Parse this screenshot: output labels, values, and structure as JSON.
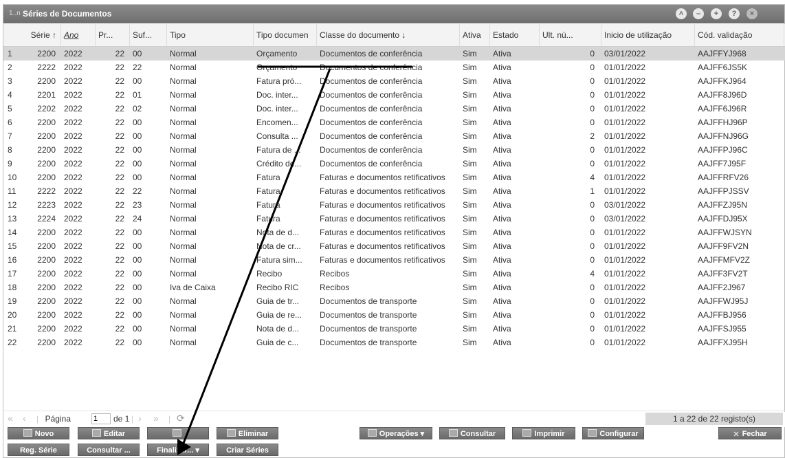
{
  "window": {
    "title": "Séries de Documentos",
    "title_icon": "1..n"
  },
  "columns": [
    {
      "label": "Série ↑"
    },
    {
      "label": "Ano"
    },
    {
      "label": "Pr..."
    },
    {
      "label": "Suf..."
    },
    {
      "label": "Tipo"
    },
    {
      "label": "Tipo documen"
    },
    {
      "label": "Classe do documento ↓"
    },
    {
      "label": "Ativa"
    },
    {
      "label": "Estado"
    },
    {
      "label": "Ult. nú..."
    },
    {
      "label": "Inicio de utilização"
    },
    {
      "label": "Cód. validação"
    }
  ],
  "rows": [
    {
      "n": "1",
      "serie": "2200",
      "ano": "2022",
      "pr": "22",
      "suf": "00",
      "tipo": "Normal",
      "tipodoc": "Orçamento",
      "classe": "Documentos de conferência",
      "ativa": "Sim",
      "estado": "Ativa",
      "ult": "0",
      "inicio": "03/01/2022",
      "cod": "AAJFFYJ968"
    },
    {
      "n": "2",
      "serie": "2222",
      "ano": "2022",
      "pr": "22",
      "suf": "22",
      "tipo": "Normal",
      "tipodoc": "Orçamento",
      "classe": "Documentos de conferência",
      "ativa": "Sim",
      "estado": "Ativa",
      "ult": "0",
      "inicio": "01/01/2022",
      "cod": "AAJFF6JS5K"
    },
    {
      "n": "3",
      "serie": "2200",
      "ano": "2022",
      "pr": "22",
      "suf": "00",
      "tipo": "Normal",
      "tipodoc": "Fatura pró...",
      "classe": "Documentos de conferência",
      "ativa": "Sim",
      "estado": "Ativa",
      "ult": "0",
      "inicio": "01/01/2022",
      "cod": "AAJFFKJ964"
    },
    {
      "n": "4",
      "serie": "2201",
      "ano": "2022",
      "pr": "22",
      "suf": "01",
      "tipo": "Normal",
      "tipodoc": "Doc. inter...",
      "classe": "Documentos de conferência",
      "ativa": "Sim",
      "estado": "Ativa",
      "ult": "0",
      "inicio": "01/01/2022",
      "cod": "AAJFF8J96D"
    },
    {
      "n": "5",
      "serie": "2202",
      "ano": "2022",
      "pr": "22",
      "suf": "02",
      "tipo": "Normal",
      "tipodoc": "Doc. inter...",
      "classe": "Documentos de conferência",
      "ativa": "Sim",
      "estado": "Ativa",
      "ult": "0",
      "inicio": "01/01/2022",
      "cod": "AAJFF6J96R"
    },
    {
      "n": "6",
      "serie": "2200",
      "ano": "2022",
      "pr": "22",
      "suf": "00",
      "tipo": "Normal",
      "tipodoc": "Encomen...",
      "classe": "Documentos de conferência",
      "ativa": "Sim",
      "estado": "Ativa",
      "ult": "0",
      "inicio": "01/01/2022",
      "cod": "AAJFFHJ96P"
    },
    {
      "n": "7",
      "serie": "2200",
      "ano": "2022",
      "pr": "22",
      "suf": "00",
      "tipo": "Normal",
      "tipodoc": "Consulta ...",
      "classe": "Documentos de conferência",
      "ativa": "Sim",
      "estado": "Ativa",
      "ult": "2",
      "inicio": "01/01/2022",
      "cod": "AAJFFNJ96G"
    },
    {
      "n": "8",
      "serie": "2200",
      "ano": "2022",
      "pr": "22",
      "suf": "00",
      "tipo": "Normal",
      "tipodoc": "Fatura de ...",
      "classe": "Documentos de conferência",
      "ativa": "Sim",
      "estado": "Ativa",
      "ult": "0",
      "inicio": "01/01/2022",
      "cod": "AAJFFPJ96C"
    },
    {
      "n": "9",
      "serie": "2200",
      "ano": "2022",
      "pr": "22",
      "suf": "00",
      "tipo": "Normal",
      "tipodoc": "Crédito de...",
      "classe": "Documentos de conferência",
      "ativa": "Sim",
      "estado": "Ativa",
      "ult": "0",
      "inicio": "01/01/2022",
      "cod": "AAJFF7J95F"
    },
    {
      "n": "10",
      "serie": "2200",
      "ano": "2022",
      "pr": "22",
      "suf": "00",
      "tipo": "Normal",
      "tipodoc": "Fatura",
      "classe": "Faturas e documentos retificativos",
      "ativa": "Sim",
      "estado": "Ativa",
      "ult": "4",
      "inicio": "01/01/2022",
      "cod": "AAJFFRFV26"
    },
    {
      "n": "11",
      "serie": "2222",
      "ano": "2022",
      "pr": "22",
      "suf": "22",
      "tipo": "Normal",
      "tipodoc": "Fatura",
      "classe": "Faturas e documentos retificativos",
      "ativa": "Sim",
      "estado": "Ativa",
      "ult": "1",
      "inicio": "01/01/2022",
      "cod": "AAJFFPJSSV"
    },
    {
      "n": "12",
      "serie": "2223",
      "ano": "2022",
      "pr": "22",
      "suf": "23",
      "tipo": "Normal",
      "tipodoc": "Fatura",
      "classe": "Faturas e documentos retificativos",
      "ativa": "Sim",
      "estado": "Ativa",
      "ult": "0",
      "inicio": "03/01/2022",
      "cod": "AAJFFZJ95N"
    },
    {
      "n": "13",
      "serie": "2224",
      "ano": "2022",
      "pr": "22",
      "suf": "24",
      "tipo": "Normal",
      "tipodoc": "Fatura",
      "classe": "Faturas e documentos retificativos",
      "ativa": "Sim",
      "estado": "Ativa",
      "ult": "0",
      "inicio": "03/01/2022",
      "cod": "AAJFFDJ95X"
    },
    {
      "n": "14",
      "serie": "2200",
      "ano": "2022",
      "pr": "22",
      "suf": "00",
      "tipo": "Normal",
      "tipodoc": "Nota de d...",
      "classe": "Faturas e documentos retificativos",
      "ativa": "Sim",
      "estado": "Ativa",
      "ult": "0",
      "inicio": "01/01/2022",
      "cod": "AAJFFWJSYN"
    },
    {
      "n": "15",
      "serie": "2200",
      "ano": "2022",
      "pr": "22",
      "suf": "00",
      "tipo": "Normal",
      "tipodoc": "Nota de cr...",
      "classe": "Faturas e documentos retificativos",
      "ativa": "Sim",
      "estado": "Ativa",
      "ult": "0",
      "inicio": "01/01/2022",
      "cod": "AAJFF9FV2N"
    },
    {
      "n": "16",
      "serie": "2200",
      "ano": "2022",
      "pr": "22",
      "suf": "00",
      "tipo": "Normal",
      "tipodoc": "Fatura sim...",
      "classe": "Faturas e documentos retificativos",
      "ativa": "Sim",
      "estado": "Ativa",
      "ult": "0",
      "inicio": "01/01/2022",
      "cod": "AAJFFMFV2Z"
    },
    {
      "n": "17",
      "serie": "2200",
      "ano": "2022",
      "pr": "22",
      "suf": "00",
      "tipo": "Normal",
      "tipodoc": "Recibo",
      "classe": "Recibos",
      "ativa": "Sim",
      "estado": "Ativa",
      "ult": "4",
      "inicio": "01/01/2022",
      "cod": "AAJFF3FV2T"
    },
    {
      "n": "18",
      "serie": "2200",
      "ano": "2022",
      "pr": "22",
      "suf": "00",
      "tipo": "Iva de Caixa",
      "tipodoc": "Recibo RIC",
      "classe": "Recibos",
      "ativa": "Sim",
      "estado": "Ativa",
      "ult": "0",
      "inicio": "01/01/2022",
      "cod": "AAJFF2J967"
    },
    {
      "n": "19",
      "serie": "2200",
      "ano": "2022",
      "pr": "22",
      "suf": "00",
      "tipo": "Normal",
      "tipodoc": "Guia de tr...",
      "classe": "Documentos de transporte",
      "ativa": "Sim",
      "estado": "Ativa",
      "ult": "0",
      "inicio": "01/01/2022",
      "cod": "AAJFFWJ95J"
    },
    {
      "n": "20",
      "serie": "2200",
      "ano": "2022",
      "pr": "22",
      "suf": "00",
      "tipo": "Normal",
      "tipodoc": "Guia de re...",
      "classe": "Documentos de transporte",
      "ativa": "Sim",
      "estado": "Ativa",
      "ult": "0",
      "inicio": "01/01/2022",
      "cod": "AAJFFBJ956"
    },
    {
      "n": "21",
      "serie": "2200",
      "ano": "2022",
      "pr": "22",
      "suf": "00",
      "tipo": "Normal",
      "tipodoc": "Nota de d...",
      "classe": "Documentos de transporte",
      "ativa": "Sim",
      "estado": "Ativa",
      "ult": "0",
      "inicio": "01/01/2022",
      "cod": "AAJFFSJ955"
    },
    {
      "n": "22",
      "serie": "2200",
      "ano": "2022",
      "pr": "22",
      "suf": "00",
      "tipo": "Normal",
      "tipodoc": "Guia de c...",
      "classe": "Documentos de transporte",
      "ativa": "Sim",
      "estado": "Ativa",
      "ult": "0",
      "inicio": "01/01/2022",
      "cod": "AAJFFXJ95H"
    }
  ],
  "pager": {
    "page_label": "Página",
    "page_value": "1",
    "of_label": "de 1",
    "record_count": "1 a 22 de 22 registo(s)"
  },
  "toolbar": {
    "novo": "Novo",
    "editar": "Editar",
    "eliminar": "Eliminar",
    "operacoes": "Operações ▾",
    "consultar": "Consultar",
    "imprimir": "Imprimir",
    "configurar": "Configurar",
    "fechar": "Fechar",
    "reg_serie": "Reg. Série",
    "consultar_more": "Consultar ...",
    "finalizar": "Finalizar... ▾",
    "criar_series": "Criar Séries"
  },
  "colors": {
    "titlebar": "#7a7a7a",
    "selected_row": "#d6d6d6",
    "button": "#777777",
    "annotation": "#000000"
  }
}
